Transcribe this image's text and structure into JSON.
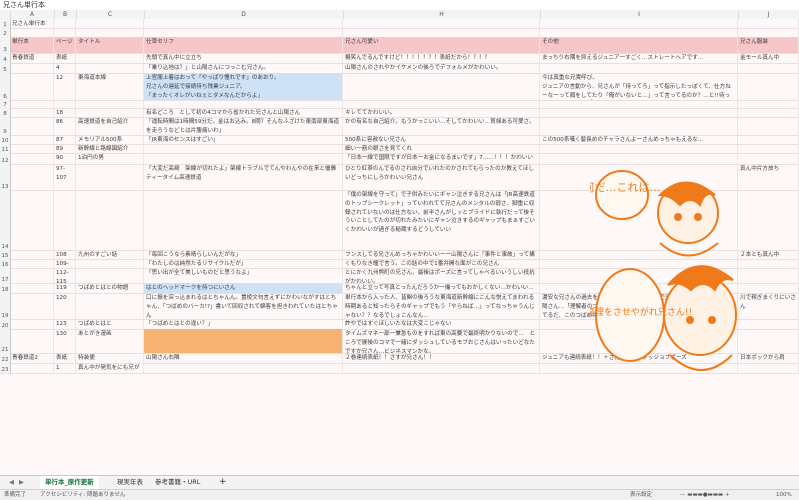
{
  "formula_bar": {
    "value": "兄さん単行本"
  },
  "columns": [
    "A",
    "B",
    "C",
    "D",
    "H",
    "I",
    "J"
  ],
  "rows": [
    {
      "num": "1",
      "cells": {
        "A": "兄さん単行本"
      }
    },
    {
      "num": "2",
      "cells": {}
    },
    {
      "num": "3",
      "cells": {
        "A": "単行本",
        "B": "ページ",
        "C": "タイトル",
        "D": "仕草セリフ",
        "H": "兄さん可愛い",
        "I": "その他",
        "J": "兄さん服装"
      }
    },
    {
      "num": "4",
      "cells": {
        "A": "青春鉄道",
        "B": "表紙",
        "D": "先頭で真ん中に立立ち",
        "H": "擬笑んでるんですけど！！！！！？！表紙だから！？！？",
        "I": "まっちり右隅を抑えるジュニア一すごく…ストレートへアです…",
        "J": "金モール真ん中"
      }
    },
    {
      "num": "5",
      "cells": {
        "B": "4",
        "D": "「乗り込地は？」と山陽さんにつっこむ兄さん。",
        "H": "山陽さんのされやかイケメンの後ろでデフォルメがかわいい。"
      }
    },
    {
      "num": "6",
      "cells": {
        "B": "12",
        "C": "東海道本線",
        "D": "上官服上着はおって「やっぱり憧れです」のあおり。\n兄さんの遅延で接続待ち残業ジュニア。\n「まったくオレがいねぇとダメなんだからよ」",
        "I": "今は真重な兄貴呼び。\nジュニアの言動から、兄さんが「待ってろ」って指示したっぽくて、仕方ねーなーって顔をしてたり「俺がいないと…」って言ってるのか？…と!!待ってます。!!(´・ω・｀"
      }
    },
    {
      "num": "7",
      "cells": {}
    },
    {
      "num": "8",
      "cells": {
        "B": "18",
        "D": "有名どころ　として初の4コマから省かれた兄さんと山陽さん",
        "H": "キレててかわいい。"
      }
    },
    {
      "num": "9",
      "cells": {
        "B": "86",
        "C": "高速鉄道を自己紹介",
        "D": "「運転時間は1時間59分だ。金はお込み。8問？そんなふざけた東南部東海道を走ろうなどとは片腹痛いわ」",
        "H": "かの有名な自己紹介。もうかっこいい…そしてかわいい…貫禄ある可愛さ。"
      }
    },
    {
      "num": "10",
      "cells": {
        "B": "87",
        "C": "メモリアル500系",
        "D": "「JR東海のセンスはすごい」",
        "H": "500系に容赦ない兄さん",
        "I": "この500系嘆く髪長めのチャラさんよーさんめっちゃもえるな…"
      }
    },
    {
      "num": "11",
      "cells": {
        "B": "89",
        "C": "新幹線と路線図紹介",
        "H": "細い一筋の眼さを見てくれ"
      }
    },
    {
      "num": "12",
      "cells": {
        "B": "90",
        "C": "1泊円の男",
        "H": "「日本一線で国限ですが日本一お金になるまいです」7……！！！かわいい"
      }
    },
    {
      "num": "13",
      "cells": {
        "B": "97-107",
        "D": "「大変だ高崎　架線が切れたよ」架線トラブルでてんやわんやの在来と優雅ティータイム高速鉄道",
        "H": "ひとり紅茶のんでるのされ自分でいれたのかされてもらったのか教えてほしいどっちにしろかわいい兄さん",
        "J": "真ん中片方放ち"
      }
    },
    {
      "num": "14",
      "cells": {
        "H": "「僕の架線を守って」で子供みたいにギャン泣きする兄さんは「JR高速鉄道のトップシークレット」っていわれてて兄さんのメンタルの弱さ、脚重に収録されていないのは仕方ない。前半さんがしッとプライドに執行だって後そういことしてたのが切れたみたいにギャン泣きするのギャップもまぁすごいくかわいいが過ぎる秘蔵するどうしていい"
      }
    },
    {
      "num": "15",
      "cells": {
        "B": "108",
        "C": "九州のすごい話",
        "D": "「毎回こうなら素晴らしいんだがな」",
        "H": "フンスしてる兄さんめっちゃかわいいーー山陽さんに「事件と事故」って構ってこうかれてビビってするのかわいい",
        "J": "２本とも真ん中"
      }
    },
    {
      "num": "16",
      "cells": {
        "B": "109-110",
        "D": "「わたしのは純然たるリサイクルだが」",
        "H": "くもりなき瞳で言う。この話の中で1番弁開な面がこの兄さん"
      }
    },
    {
      "num": "17",
      "cells": {
        "B": "112-115",
        "D": "「思い出が全て美しいものだと思うなよ」",
        "H": "とにかく九州熊町の兄さん、最後はポーズに言ってしゃべるいいうしい抵抗がかわいい。"
      }
    },
    {
      "num": "18",
      "cells": {
        "B": "119",
        "C": "つばめとはとの物語",
        "D": "はとのヘッドマークを持つにいさん",
        "H": "ちゃんと立って写真とったんだろうか一撮ってもおかしくない…かわいい…"
      }
    },
    {
      "num": "19",
      "cells": {
        "B": "120",
        "D": "口に振を突っ込まれるはとちゃんん。置棱文句言えずにかわいながすはとちゃん、「つばめのバーカ!?」書いて回収されて綿客を担きわれていたはとちゃん",
        "H": "単行本から入った人、皆関の後ろうな東海道新幹線にこんな悦えてまわれる時期あると知ったらそのギャップでもう「やらねば…」ってなっちゃうんじゃない？？なるでしょこんなん…",
        "I": "濃安な兄さんの過去を知りつつ当時につっこんで兄さんの状況を推察する山陽さん…「理解者のつもり」って書かれるだけある…つばめをまぁ話もらってるだ、このつばめのことー…ね…",
        "J": "川で稼ぎまくりにいさん"
      }
    },
    {
      "num": "20",
      "cells": {
        "B": "123",
        "C": "つばめとはと",
        "D": "「つばめとはとの違い？」",
        "H": "許やではすぐほしいたなは大変こじゃない"
      }
    },
    {
      "num": "21",
      "cells": {
        "B": "130",
        "C": "あとがき漫画",
        "H": "タイムズマネー部一兼急ものをすれば東の高要で最終明かりないので…　ところで展後のコマで一緒にダッシュしているモブおじさんはいったいどなたですか兄さん…ビジネスマンかな。"
      }
    },
    {
      "num": "22",
      "cells": {
        "A": "青春鉄道2",
        "B": "表紙",
        "C": "特装便",
        "D": "山陽さん右隣",
        "H": "２巻連続表紙！！さすが兄さん！！",
        "I": "ジュニアも連続表紙！！＋さんよーさんグッジョブポーズ",
        "J": "日本ボックから肩"
      }
    },
    {
      "num": "23",
      "cells": {
        "B": "1",
        "C": "真ん中が発気をにも兄がち兄さん"
      }
    }
  ],
  "sheet_tabs": [
    "単行本_原作更新",
    "現実年表",
    "参考書籍・URL"
  ],
  "add_sheet": "+",
  "status": {
    "mode": "準備完了",
    "accessibility": "アクセシビリティ: 問題ありません",
    "view": "表示設定",
    "zoom": "100%"
  },
  "illustration": {
    "text1": "何だ…これは…",
    "text2": "心の整理をさせやがれ兄さん!!"
  },
  "colors": {
    "header": "#f7c6c6",
    "blue": "#cfe2f5",
    "orange": "#f7b272",
    "accent": "#1a7340"
  }
}
